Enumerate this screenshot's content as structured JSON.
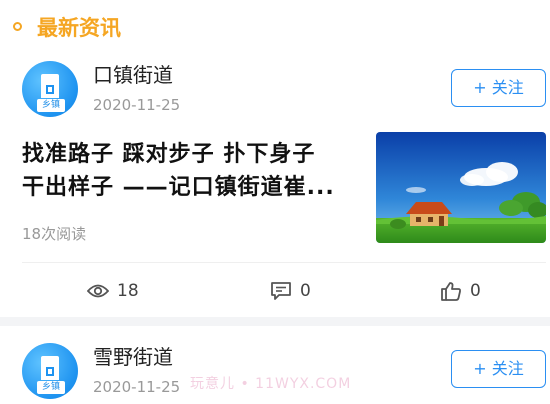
{
  "section": {
    "title": "最新资讯",
    "accent_color": "#f5a623"
  },
  "avatar_tag": "乡镇",
  "posts": [
    {
      "author": "口镇街道",
      "date": "2020-11-25",
      "follow_label": "+ 关注",
      "headline_line1": "找准路子 踩对步子 扑下身子",
      "headline_line2": "干出样子 ——记口镇街道崔...",
      "reads": "18次阅读",
      "thumbnail": "house-on-grass-landscape",
      "stats": {
        "views": "18",
        "comments": "0",
        "likes": "0"
      }
    },
    {
      "author": "雪野街道",
      "date": "2020-11-25",
      "follow_label": "+ 关注"
    }
  ],
  "watermark": "玩意儿 • 11WYX.COM",
  "colors": {
    "brand_blue": "#2b8ff2",
    "avatar_blue": "#1e93f0",
    "muted_text": "#999999"
  },
  "icons": {
    "views": "eye-icon",
    "comments": "comment-icon",
    "likes": "thumbs-up-icon"
  }
}
